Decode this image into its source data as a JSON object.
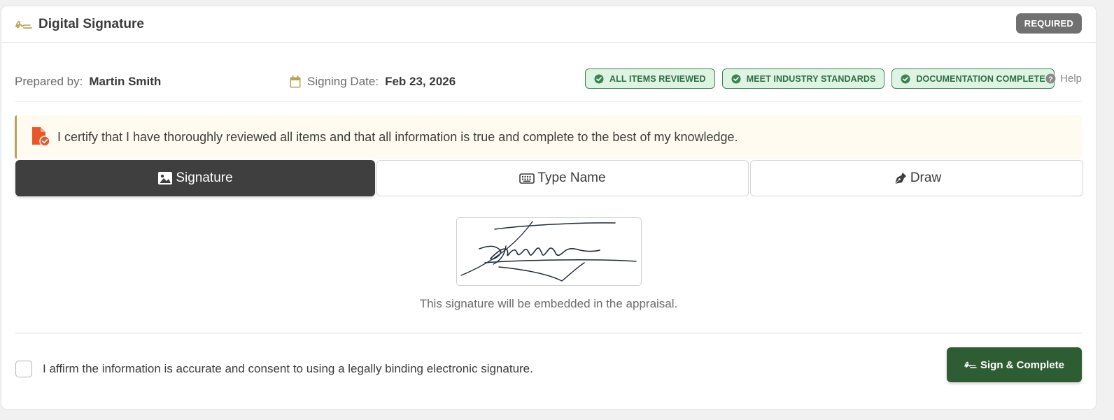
{
  "header": {
    "title": "Digital Signature",
    "badge": "REQUIRED",
    "icon": "signature-icon"
  },
  "meta": {
    "prepared_label": "Prepared by:",
    "prepared_value": "Martin Smith",
    "date_label": "Signing Date:",
    "date_value": "Feb 23, 2026",
    "help_label": "Help"
  },
  "pills": [
    {
      "label": "ALL ITEMS REVIEWED"
    },
    {
      "label": "MEET INDUSTRY STANDARDS"
    },
    {
      "label": "DOCUMENTATION COMPLETE"
    }
  ],
  "certification": {
    "text": "I certify that I have thoroughly reviewed all items and that all information is true and complete to the best of my knowledge."
  },
  "tabs": [
    {
      "label": "Signature",
      "icon": "image-icon",
      "active": true
    },
    {
      "label": "Type Name",
      "icon": "keyboard-icon",
      "active": false
    },
    {
      "label": "Draw",
      "icon": "pen-nib-icon",
      "active": false
    }
  ],
  "signature": {
    "caption": "This signature will be embedded in the appraisal."
  },
  "consent": {
    "text": "I affirm the information is accurate and consent to using a legally binding electronic signature.",
    "checked": false
  },
  "action": {
    "label": "Sign & Complete"
  },
  "colors": {
    "accent_gold": "#b9a25a",
    "success_green": "#2f5d33",
    "pill_bg": "#ddf4e3",
    "dark_tab": "#3f3f3f",
    "cert_icon": "#e8572a"
  }
}
